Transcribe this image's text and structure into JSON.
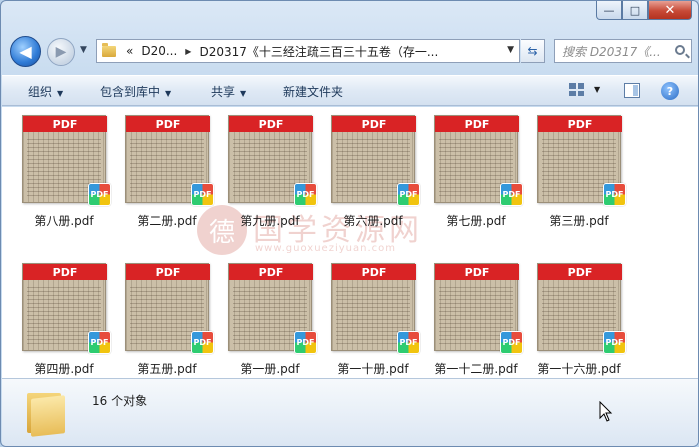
{
  "window": {
    "controls": {
      "minimize": "—",
      "maximize": "□",
      "close": "✕"
    }
  },
  "nav": {
    "back": "◀",
    "forward": "▶"
  },
  "address": {
    "overflow": "«",
    "crumbs": [
      "D20...",
      "D20317《十三经注疏三百三十五卷（存一..."
    ]
  },
  "search": {
    "placeholder": "搜索 D20317《..."
  },
  "toolbar": {
    "organize": "组织",
    "include": "包含到库中",
    "share": "共享",
    "new_folder": "新建文件夹",
    "help": "?"
  },
  "files": [
    {
      "name": "第八册.pdf",
      "banner": "PDF",
      "badge": "PDF"
    },
    {
      "name": "第二册.pdf",
      "banner": "PDF",
      "badge": "PDF"
    },
    {
      "name": "第九册.pdf",
      "banner": "PDF",
      "badge": "PDF"
    },
    {
      "name": "第六册.pdf",
      "banner": "PDF",
      "badge": "PDF"
    },
    {
      "name": "第七册.pdf",
      "banner": "PDF",
      "badge": "PDF"
    },
    {
      "name": "第三册.pdf",
      "banner": "PDF",
      "badge": "PDF"
    },
    {
      "name": "第四册.pdf",
      "banner": "PDF",
      "badge": "PDF"
    },
    {
      "name": "第五册.pdf",
      "banner": "PDF",
      "badge": "PDF"
    },
    {
      "name": "第一册.pdf",
      "banner": "PDF",
      "badge": "PDF"
    },
    {
      "name": "第一十册.pdf",
      "banner": "PDF",
      "badge": "PDF"
    },
    {
      "name": "第一十二册.pdf",
      "banner": "PDF",
      "badge": "PDF"
    },
    {
      "name": "第一十六册.pdf",
      "banner": "PDF",
      "badge": "PDF"
    }
  ],
  "watermark": {
    "logo": "德",
    "title": "国学资源网",
    "url": "www.guoxueziyuan.com"
  },
  "status": {
    "count": "16 个对象"
  },
  "colors": {
    "pdf_red": "#d92325",
    "accent": "#2f7bd6"
  }
}
